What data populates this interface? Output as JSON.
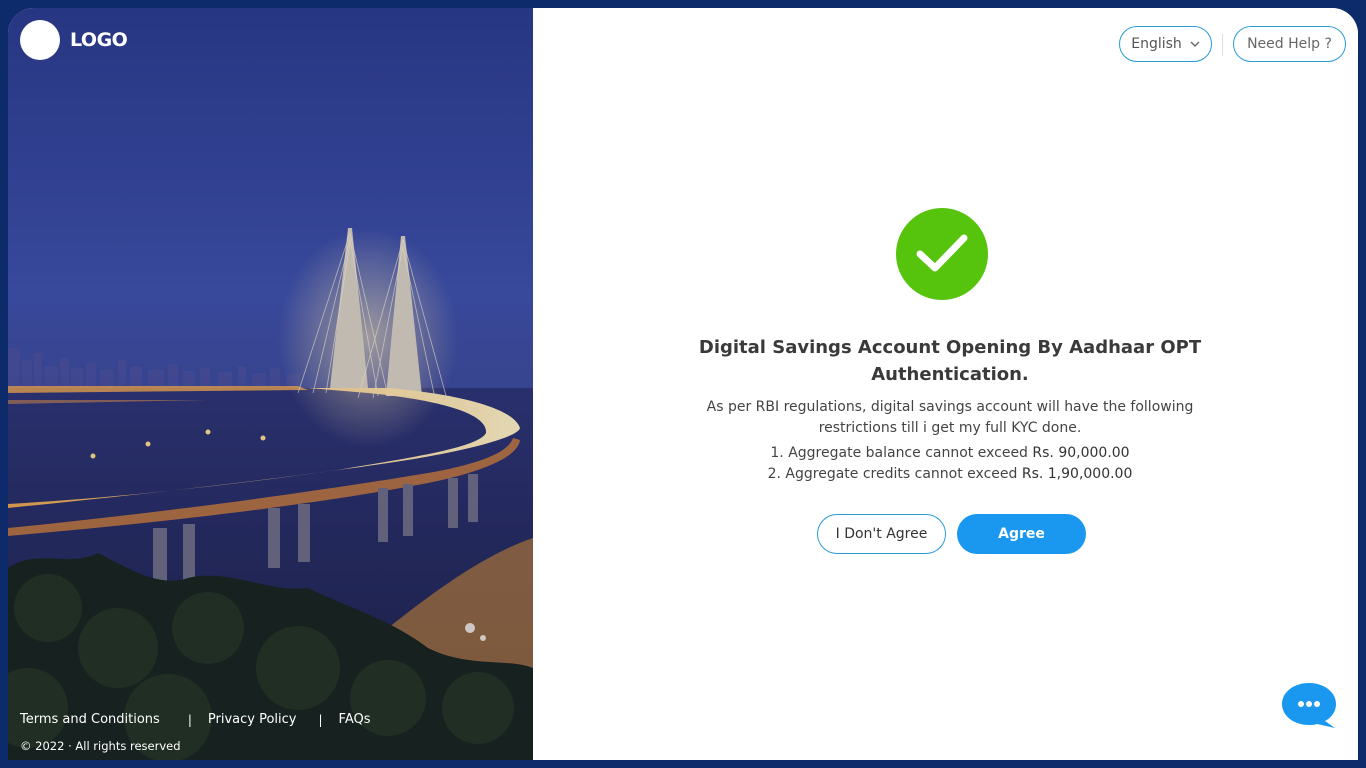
{
  "brand": {
    "logo_text": "LOGO"
  },
  "header": {
    "language": "English",
    "help_label": "Need Help ?"
  },
  "content": {
    "title": "Digital Savings Account Opening By Aadhaar OPT Authentication.",
    "description": "As per RBI regulations, digital savings account will have the following restrictions till i get my full KYC done.",
    "restrictions": [
      {
        "label": "1. Aggregate balance cannot exceed",
        "amount": "Rs. 90,000.00"
      },
      {
        "label": "2. Aggregate credits cannot exceed",
        "amount": "Rs. 1,90,000.00"
      }
    ],
    "disagree_label": "I Don't Agree",
    "agree_label": "Agree"
  },
  "footer": {
    "links": [
      "Terms and Conditions",
      "Privacy Policy",
      "FAQs"
    ],
    "copyright": "© 2022 · All rights reserved"
  },
  "icons": {
    "success": "check-circle-icon",
    "chat": "chat-bubble-icon",
    "chevron": "chevron-down-icon"
  },
  "colors": {
    "accent": "#1a98f0",
    "success": "#56c30c",
    "frame": "#0d2a6b",
    "outline": "#2a9bd8"
  }
}
